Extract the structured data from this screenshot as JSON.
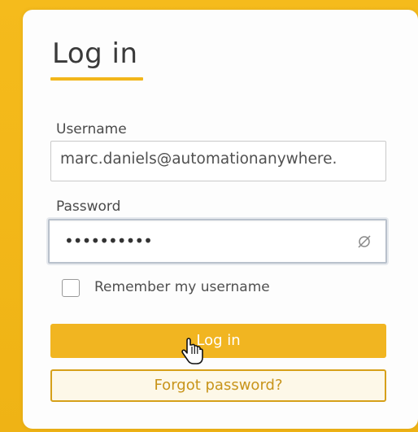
{
  "login_form": {
    "title": "Log in",
    "username": {
      "label": "Username",
      "value": "marc.daniels@automationanywhere."
    },
    "password": {
      "label": "Password",
      "masked_value": "••••••••••",
      "visibility_icon": "eye-slash-icon"
    },
    "remember": {
      "label": "Remember my username",
      "checked": false
    },
    "login_button": "Log in",
    "forgot_password_button": "Forgot password?"
  },
  "colors": {
    "accent": "#f2b61a",
    "background": "#f2b61a",
    "card": "#fdfdfd",
    "forgot_text": "#c8941a"
  },
  "cursor": "hand-pointer-icon"
}
